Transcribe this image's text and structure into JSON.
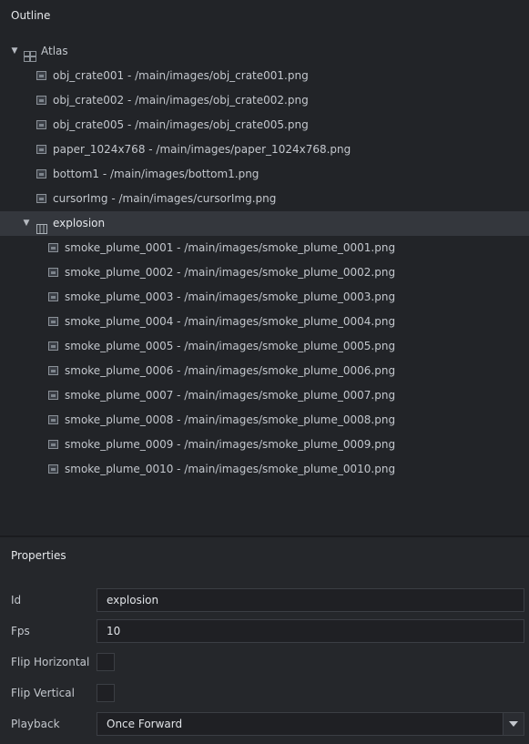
{
  "outline": {
    "title": "Outline",
    "atlas": {
      "label": "Atlas",
      "images": [
        "obj_crate001 - /main/images/obj_crate001.png",
        "obj_crate002 - /main/images/obj_crate002.png",
        "obj_crate005 - /main/images/obj_crate005.png",
        "paper_1024x768 - /main/images/paper_1024x768.png",
        "bottom1 - /main/images/bottom1.png",
        "cursorImg - /main/images/cursorImg.png"
      ],
      "animation": {
        "label": "explosion",
        "frames": [
          "smoke_plume_0001 - /main/images/smoke_plume_0001.png",
          "smoke_plume_0002 - /main/images/smoke_plume_0002.png",
          "smoke_plume_0003 - /main/images/smoke_plume_0003.png",
          "smoke_plume_0004 - /main/images/smoke_plume_0004.png",
          "smoke_plume_0005 - /main/images/smoke_plume_0005.png",
          "smoke_plume_0006 - /main/images/smoke_plume_0006.png",
          "smoke_plume_0007 - /main/images/smoke_plume_0007.png",
          "smoke_plume_0008 - /main/images/smoke_plume_0008.png",
          "smoke_plume_0009 - /main/images/smoke_plume_0009.png",
          "smoke_plume_0010 - /main/images/smoke_plume_0010.png"
        ]
      }
    }
  },
  "properties": {
    "title": "Properties",
    "id": {
      "label": "Id",
      "value": "explosion"
    },
    "fps": {
      "label": "Fps",
      "value": "10"
    },
    "flip_horizontal": {
      "label": "Flip Horizontal",
      "checked": false
    },
    "flip_vertical": {
      "label": "Flip Vertical",
      "checked": false
    },
    "playback": {
      "label": "Playback",
      "value": "Once Forward"
    }
  },
  "colors": {
    "background": "#222428",
    "selected_row": "#34373d",
    "field_bg": "#1f2024",
    "text": "#c3c7cd"
  }
}
